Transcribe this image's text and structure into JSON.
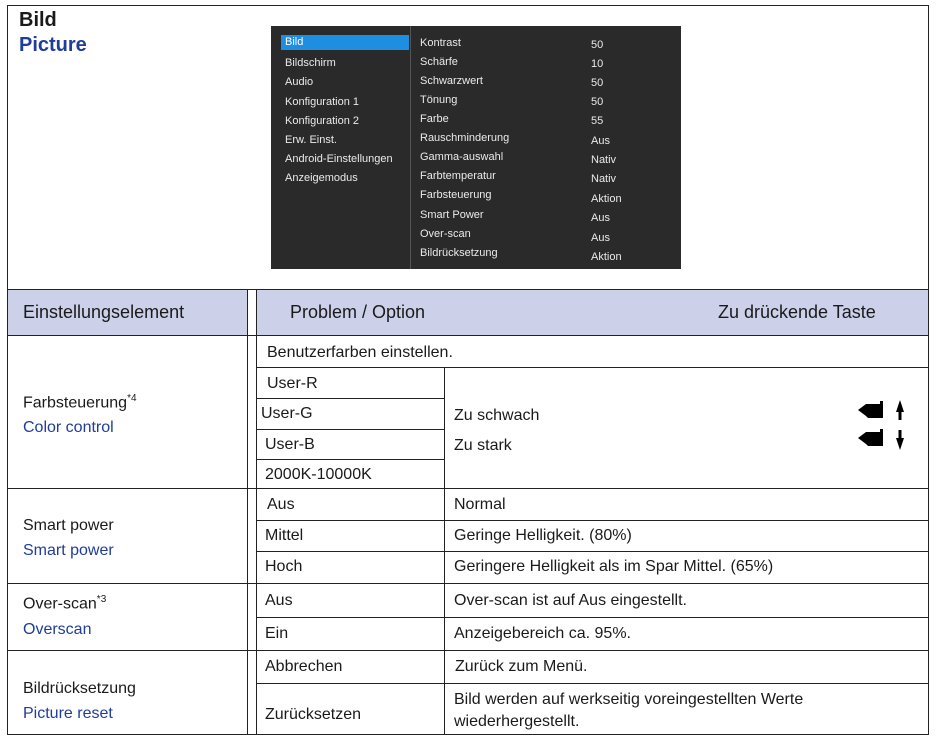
{
  "title": {
    "de": "Bild",
    "en": "Picture"
  },
  "osd": {
    "menu": [
      "Bild",
      "Bildschirm",
      "Audio",
      "Konfiguration 1",
      "Konfiguration 2",
      "Erw. Einst.",
      "Android-Einstellungen",
      "Anzeigemodus"
    ],
    "selected": "Bild",
    "settings": [
      {
        "label": "Kontrast",
        "value": "50"
      },
      {
        "label": "Schärfe",
        "value": "10"
      },
      {
        "label": "Schwarzwert",
        "value": "50"
      },
      {
        "label": "Tönung",
        "value": "50"
      },
      {
        "label": "Farbe",
        "value": "55"
      },
      {
        "label": "Rauschminderung",
        "value": "Aus"
      },
      {
        "label": "Gamma-auswahl",
        "value": "Nativ"
      },
      {
        "label": "Farbtemperatur",
        "value": "Nativ"
      },
      {
        "label": "Farbsteuerung",
        "value": "Aktion"
      },
      {
        "label": "Smart Power",
        "value": "Aus"
      },
      {
        "label": "Over-scan",
        "value": "Aus"
      },
      {
        "label": "Bildrücksetzung",
        "value": "Aktion"
      }
    ]
  },
  "table": {
    "headers": {
      "element": "Einstellungselement",
      "problem": "Problem / Option",
      "key": "Zu drückende Taste"
    },
    "color_control": {
      "de": "Farbsteuerung",
      "sup": "*4",
      "en": "Color control",
      "intro": "Benutzerfarben einstellen.",
      "options": [
        "User-R",
        "User-G",
        "User-B",
        "2000K-10000K"
      ],
      "weak": "Zu schwach",
      "strong": "Zu stark"
    },
    "smart_power": {
      "de": "Smart power",
      "en": "Smart power",
      "rows": [
        {
          "option": "Aus",
          "desc": "Normal"
        },
        {
          "option": "Mittel",
          "desc": "Geringe Helligkeit. (80%)"
        },
        {
          "option": "Hoch",
          "desc": "Geringere Helligkeit als im Spar Mittel. (65%)"
        }
      ]
    },
    "overscan": {
      "de": "Over-scan",
      "sup": "*3",
      "en": "Overscan",
      "rows": [
        {
          "option": "Aus",
          "desc": "Over-scan ist auf Aus eingestellt."
        },
        {
          "option": "Ein",
          "desc": "Anzeigebereich ca. 95%."
        }
      ]
    },
    "reset": {
      "de": "Bildrücksetzung",
      "en": "Picture reset",
      "rows": [
        {
          "option": "Abbrechen",
          "desc": "Zurück zum Menü."
        },
        {
          "option": "Zurücksetzen",
          "desc1": "Bild werden auf  werkseitig voreingestellten Werte",
          "desc2": "wiederhergestellt."
        }
      ]
    }
  },
  "colors": {
    "header_bg": "#ccd0e8",
    "english_text": "#1f3d99",
    "osd_bg": "#2a2a2a",
    "osd_highlight": "#1e8ee0"
  }
}
